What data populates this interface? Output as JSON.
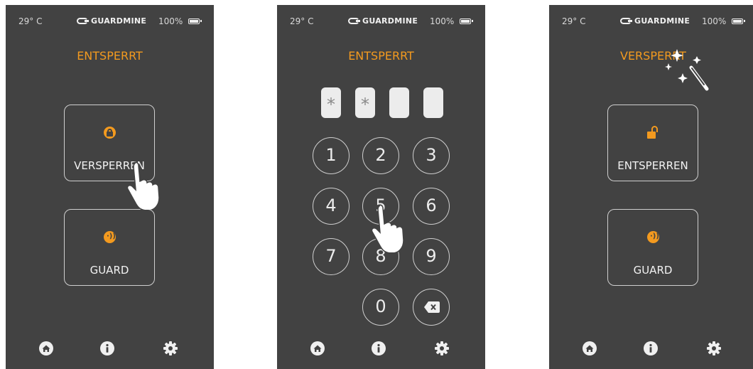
{
  "screens": [
    {
      "status": {
        "temperature": "29° C",
        "brand": "GUARDMINE",
        "battery": "100%"
      },
      "state_label": "ENTSPERRT",
      "primary_button": {
        "label": "VERSPERREN",
        "icon": "lock-icon"
      },
      "guard_button": {
        "label": "GUARD",
        "icon": "nfc-icon"
      },
      "nav": [
        "home-icon",
        "info-icon",
        "gear-icon"
      ]
    },
    {
      "status": {
        "temperature": "29° C",
        "brand": "GUARDMINE",
        "battery": "100%"
      },
      "state_label": "ENTSPERRT",
      "pin": [
        "*",
        "*",
        "",
        ""
      ],
      "keys": [
        "1",
        "2",
        "3",
        "4",
        "5",
        "6",
        "7",
        "8",
        "9",
        "0"
      ],
      "nav": [
        "home-icon",
        "info-icon",
        "gear-icon"
      ]
    },
    {
      "status": {
        "temperature": "29° C",
        "brand": "GUARDMINE",
        "battery": "100%"
      },
      "state_label": "VERSPERRT",
      "primary_button": {
        "label": "ENTSPERREN",
        "icon": "unlock-icon"
      },
      "guard_button": {
        "label": "GUARD",
        "icon": "nfc-icon"
      },
      "nav": [
        "home-icon",
        "info-icon",
        "gear-icon"
      ]
    }
  ],
  "colors": {
    "background": "#424242",
    "accent": "#f39a1f",
    "text": "#e6e6e6"
  }
}
